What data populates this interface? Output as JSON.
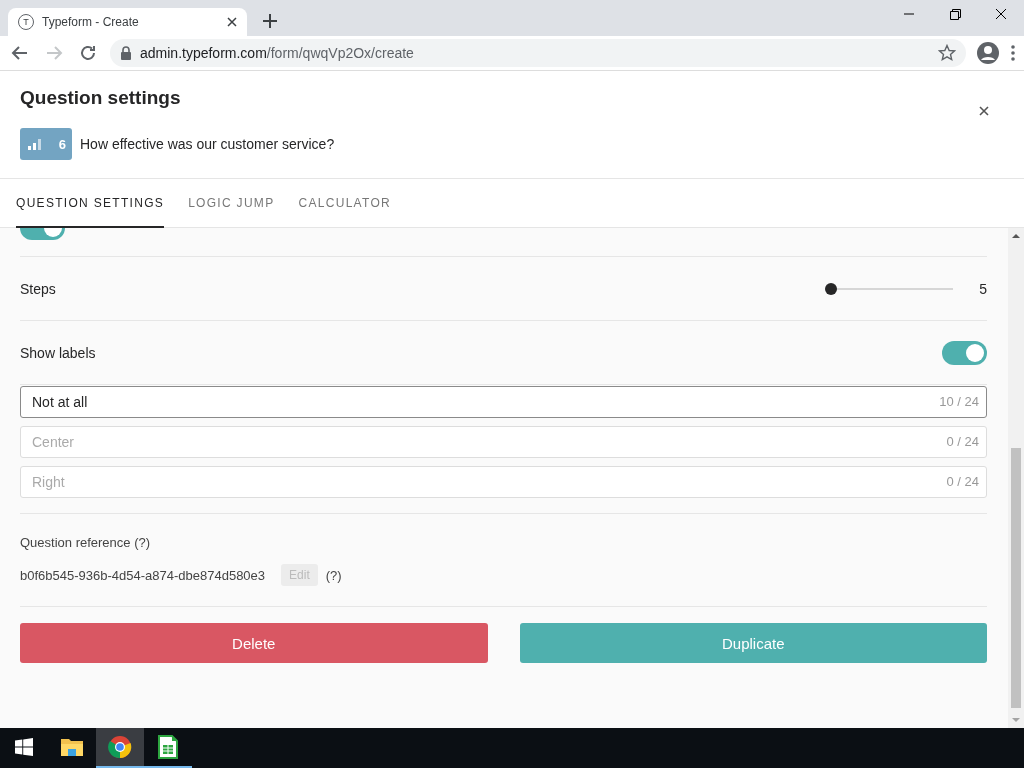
{
  "browser": {
    "tab": {
      "favicon_letter": "T",
      "title": "Typeform - Create"
    },
    "address": {
      "host": "admin.typeform.com",
      "path": "/form/qwqVp2Ox/create"
    },
    "forward_disabled": true
  },
  "header": {
    "title": "Question settings",
    "question": {
      "number": "6",
      "text": "How effective was our customer service?"
    }
  },
  "tabs": [
    {
      "label": "QUESTION SETTINGS",
      "selected": true
    },
    {
      "label": "LOGIC JUMP",
      "selected": false
    },
    {
      "label": "CALCULATOR",
      "selected": false
    }
  ],
  "settings": {
    "scrolled_toggle": {
      "on": true
    },
    "steps": {
      "label": "Steps",
      "level": 0,
      "reading": "5"
    },
    "show_labels": {
      "label": "Show labels",
      "on": true
    },
    "label_fields": [
      {
        "value": "Not at all",
        "counter": "10 / 24",
        "focused": true
      },
      {
        "placeholder": "Center",
        "counter": "0 / 24",
        "focused": false
      },
      {
        "placeholder": "Right",
        "counter": "0 / 24",
        "focused": false
      }
    ],
    "reference": {
      "title": "Question reference",
      "help": "(?)",
      "value": "b0f6b545-936b-4d54-a874-dbe874d580e3",
      "edit": "Edit",
      "help2": "(?)"
    },
    "buttons": [
      {
        "kind": "danger",
        "label": "Delete"
      },
      {
        "kind": "primary",
        "label": "Duplicate"
      }
    ]
  },
  "taskbar": [
    {
      "kind": "folder",
      "selected": false,
      "running": false
    },
    {
      "kind": "browser",
      "selected": true,
      "running": true
    },
    {
      "kind": "spreadsheet",
      "selected": false,
      "running": true
    }
  ]
}
